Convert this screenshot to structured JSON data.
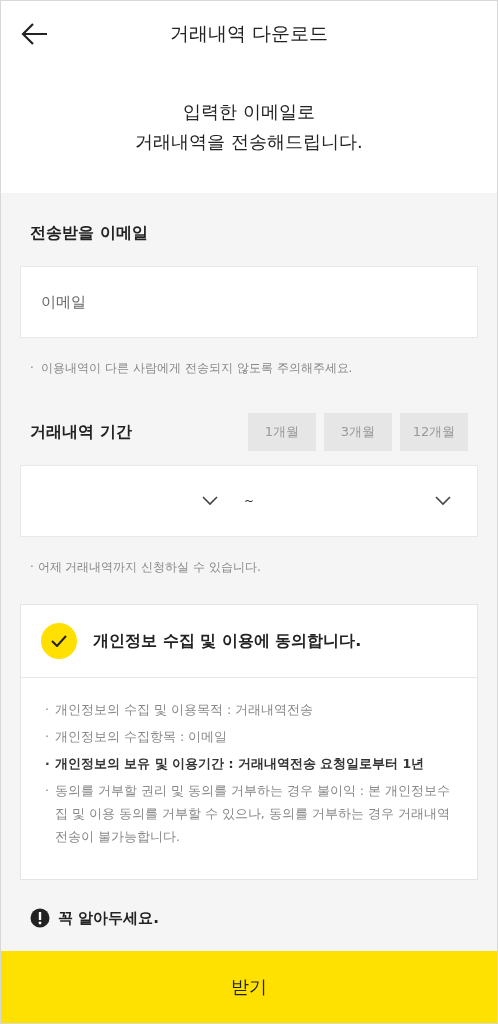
{
  "header": {
    "title": "거래내역 다운로드"
  },
  "intro": [
    "입력한 이메일로",
    "거래내역을 전송해드립니다."
  ],
  "email_section": {
    "label": "전송받을 이메일",
    "field": {
      "placeholder": "이메일"
    },
    "hint": "·  이용내역이 다른 사람에게 전송되지 않도록 주의해주세요."
  },
  "period_section": {
    "label": "거래내역 기간",
    "presets": [
      {
        "label": "1개월",
        "selected": false
      },
      {
        "label": "3개월",
        "selected": false
      },
      {
        "label": "12개월",
        "selected": false
      }
    ],
    "separator": "~",
    "hint": "· 어제 거래내역까지 신청하실 수 있습니다."
  },
  "consent": {
    "title": "개인정보 수집 및 이용에 동의합니다.",
    "checked": true,
    "bullet": "·",
    "items": [
      {
        "text": "개인정보의 수집 및 이용목적 : 거래내역전송",
        "bold": false
      },
      {
        "text": "개인정보의 수집항목 : 이메일",
        "bold": false
      },
      {
        "text": "개인정보의 보유 및 이용기간 : 거래내역전송 요청일로부터 1년",
        "bold": true
      },
      {
        "text": "동의를 거부할 권리 및 동의를 거부하는 경우 불이익 : 본 개인정보수집 및 이용 동의를 거부할 수 있으나, 동의를 거부하는 경우 거래내역전송이 불가능합니다.",
        "bold": false
      }
    ]
  },
  "notice": {
    "title": "꼭 알아두세요."
  },
  "submit_button": {
    "label": "받기"
  }
}
